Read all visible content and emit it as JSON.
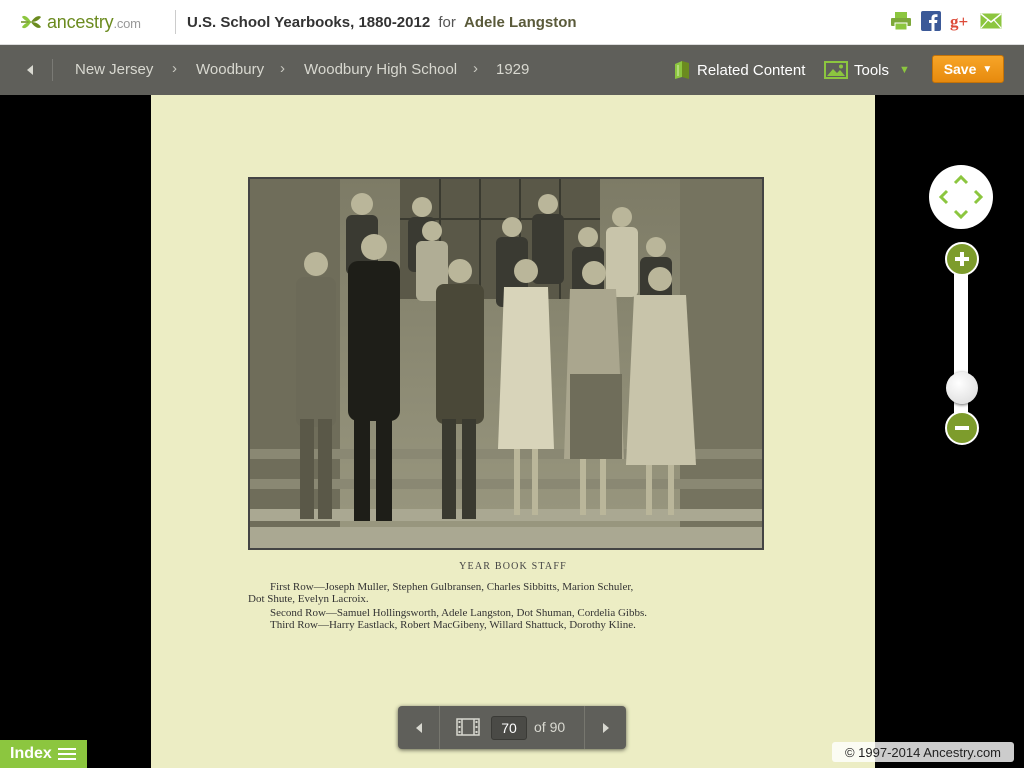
{
  "header": {
    "logo_text": "ancestry",
    "logo_suffix": ".com",
    "collection_title": "U.S. School Yearbooks, 1880-2012",
    "for_text": "for",
    "person_name": "Adele Langston"
  },
  "breadcrumb": {
    "items": [
      "New Jersey",
      "Woodbury",
      "Woodbury High School",
      "1929"
    ]
  },
  "toolbar": {
    "related_label": "Related Content",
    "tools_label": "Tools",
    "save_label": "Save"
  },
  "yearbook": {
    "caption_title": "YEAR BOOK STAFF",
    "lines": [
      "First Row—Joseph Muller, Stephen Gulbransen, Charles Sibbitts, Marion Schuler,",
      "Dot Shute, Evelyn Lacroix.",
      "Second Row—Samuel Hollingsworth, Adele Langston, Dot Shuman, Cordelia Gibbs.",
      "Third Row—Harry Eastlack, Robert MacGibeny, Willard Shattuck, Dorothy Kline."
    ]
  },
  "pager": {
    "current_page": "70",
    "of_text": "of 90"
  },
  "index_label": "Index",
  "copyright": "© 1997-2014 Ancestry.com",
  "colors": {
    "brand_green": "#8cc63f",
    "save_orange": "#f39c1a",
    "nav_bg": "#5f5f5a"
  }
}
